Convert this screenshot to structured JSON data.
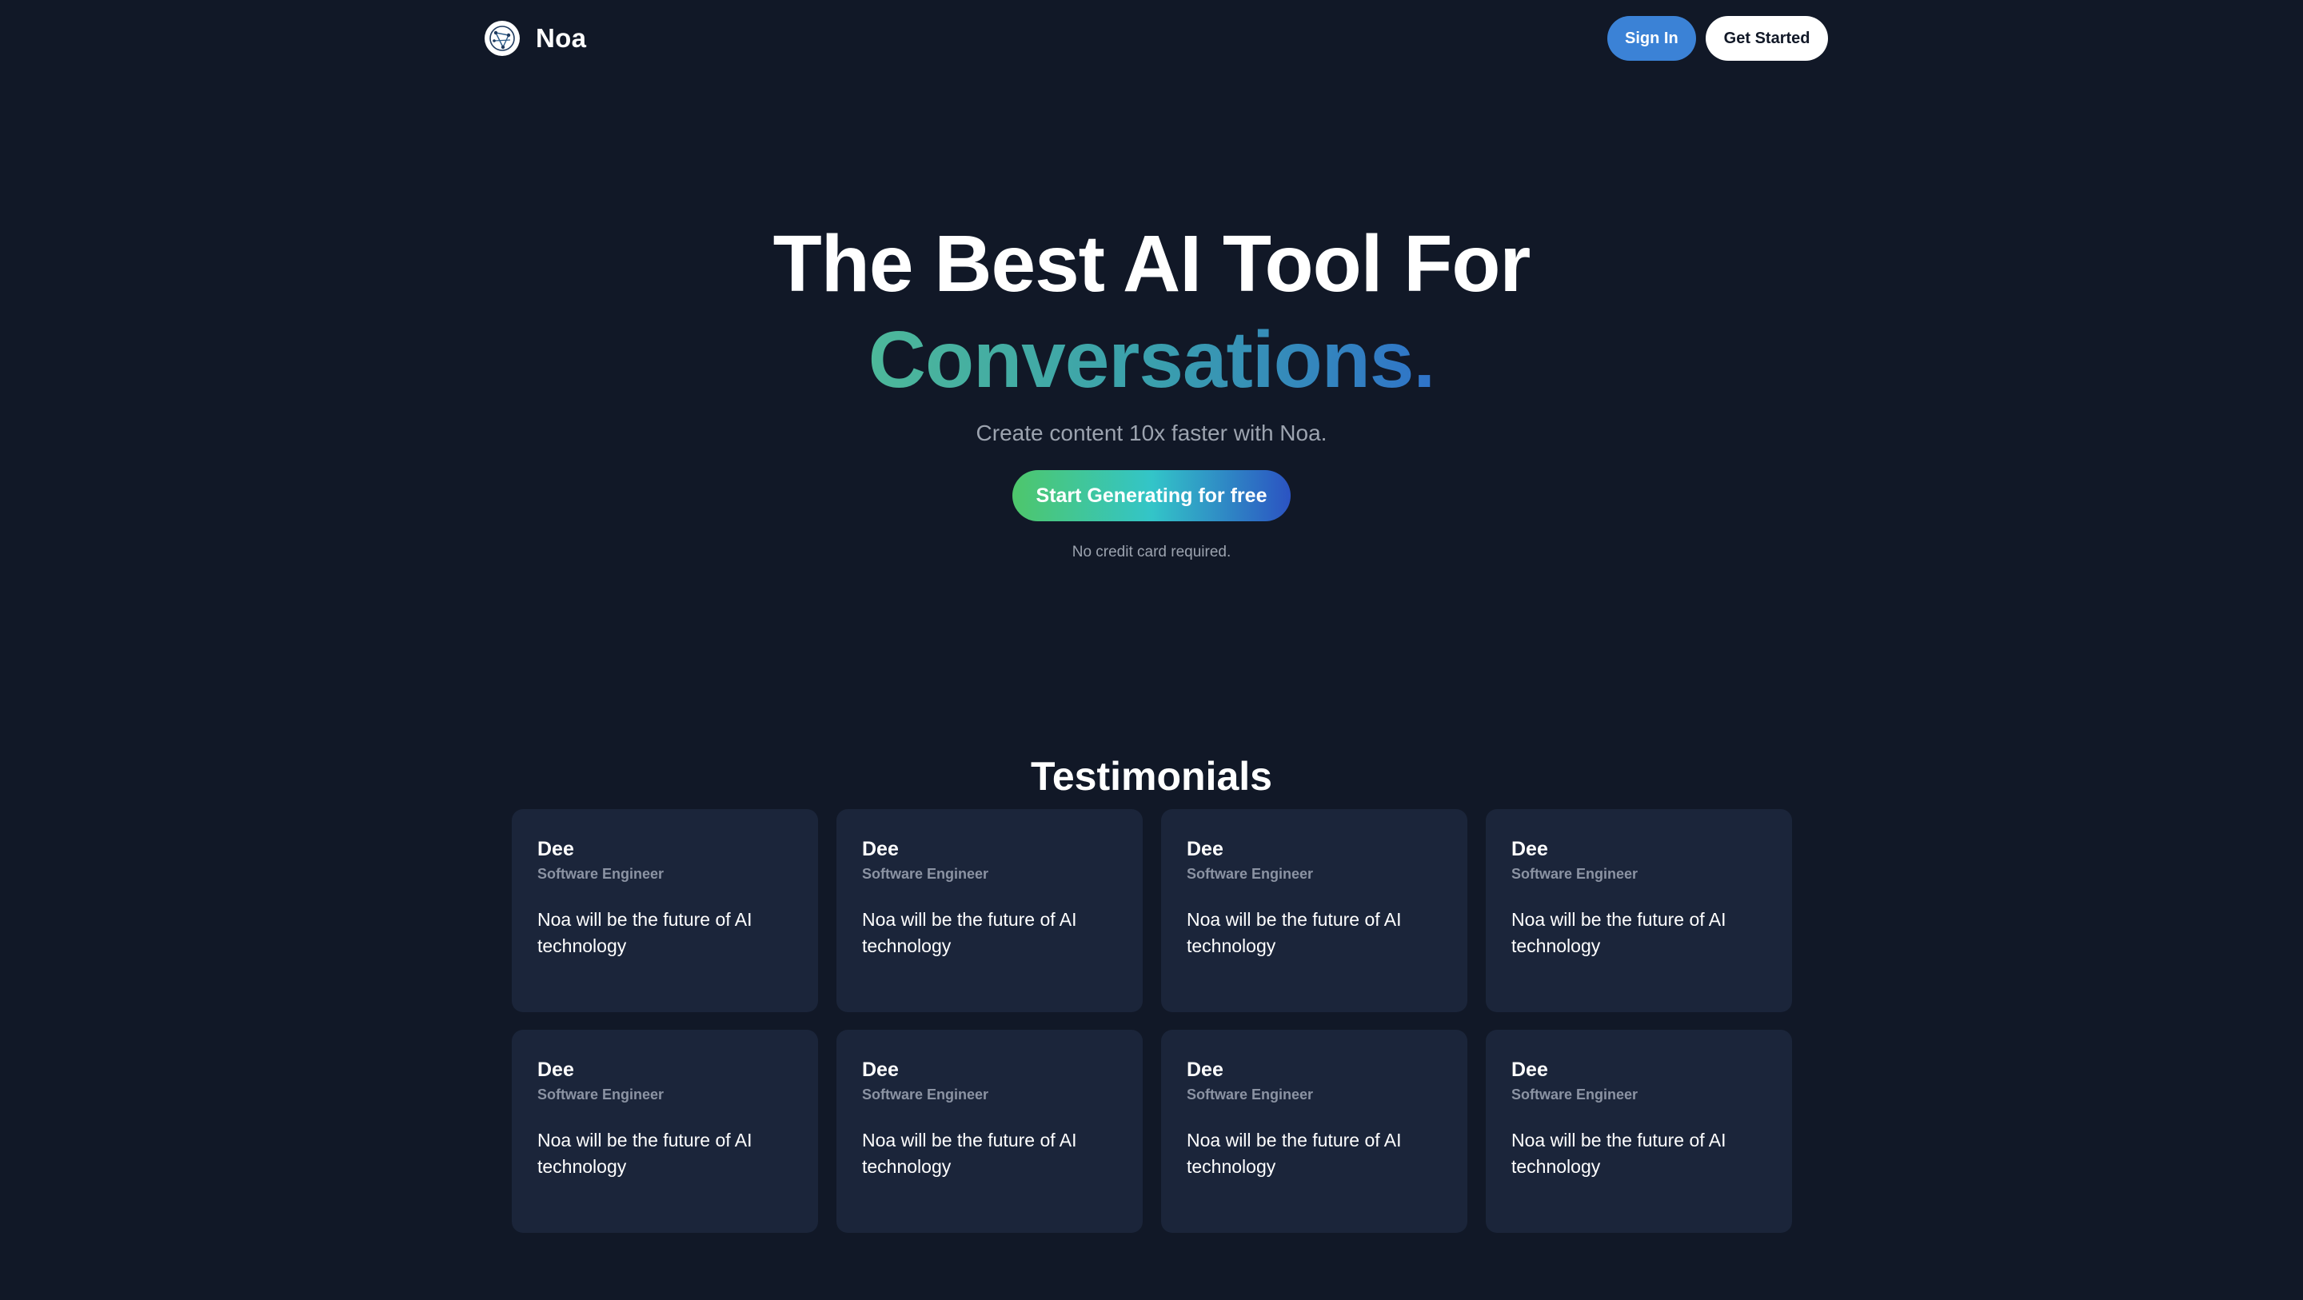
{
  "navbar": {
    "brand_name": "Noa",
    "logo_icon": "globe-logo-icon",
    "signin_label": "Sign In",
    "getstarted_label": "Get Started"
  },
  "hero": {
    "title_line1": "The Best AI Tool For",
    "title_line2": "Conversations.",
    "subtitle": "Create content 10x faster with Noa.",
    "cta_label": "Start Generating for free",
    "note": "No credit card required."
  },
  "testimonials": {
    "title": "Testimonials",
    "items": [
      {
        "name": "Dee",
        "role": "Software Engineer",
        "quote": "Noa will be the future of AI technology"
      },
      {
        "name": "Dee",
        "role": "Software Engineer",
        "quote": "Noa will be the future of AI technology"
      },
      {
        "name": "Dee",
        "role": "Software Engineer",
        "quote": "Noa will be the future of AI technology"
      },
      {
        "name": "Dee",
        "role": "Software Engineer",
        "quote": "Noa will be the future of AI technology"
      },
      {
        "name": "Dee",
        "role": "Software Engineer",
        "quote": "Noa will be the future of AI technology"
      },
      {
        "name": "Dee",
        "role": "Software Engineer",
        "quote": "Noa will be the future of AI technology"
      },
      {
        "name": "Dee",
        "role": "Software Engineer",
        "quote": "Noa will be the future of AI technology"
      },
      {
        "name": "Dee",
        "role": "Software Engineer",
        "quote": "Noa will be the future of AI technology"
      }
    ]
  },
  "colors": {
    "background": "#111827",
    "card": "#1b253a",
    "signin": "#3b82d6",
    "accent_gradient_start": "#4db89a",
    "accent_gradient_end": "#2f73c9"
  }
}
